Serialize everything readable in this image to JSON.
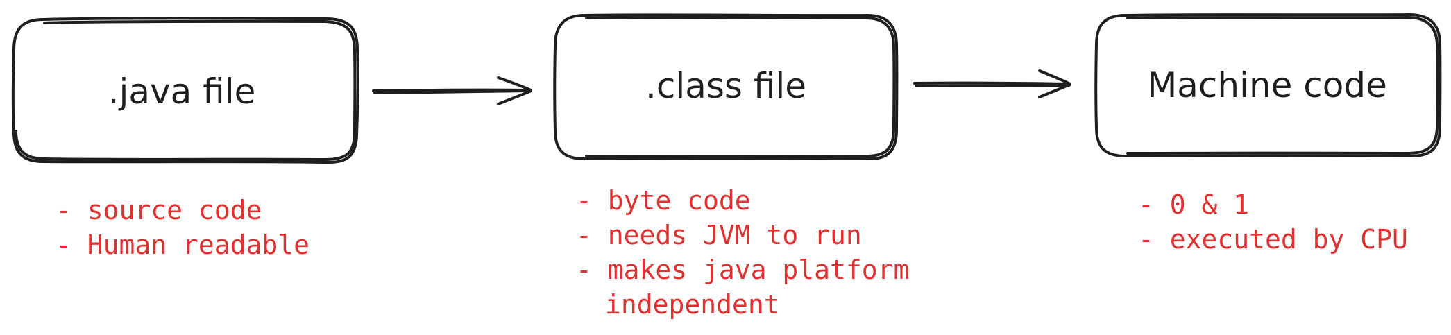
{
  "boxes": [
    {
      "id": "java",
      "label": ".java file"
    },
    {
      "id": "class",
      "label": ".class file"
    },
    {
      "id": "machine",
      "label": "Machine code"
    }
  ],
  "notes": {
    "java": [
      "- source code",
      "- Human readable"
    ],
    "class": [
      "- byte code",
      "- needs JVM to run",
      "- makes java platform",
      "independent"
    ],
    "machine": [
      "- 0 & 1",
      "- executed by CPU"
    ]
  },
  "colors": {
    "stroke": "#1e1e1e",
    "note": "#e03131",
    "background": "#ffffff"
  }
}
